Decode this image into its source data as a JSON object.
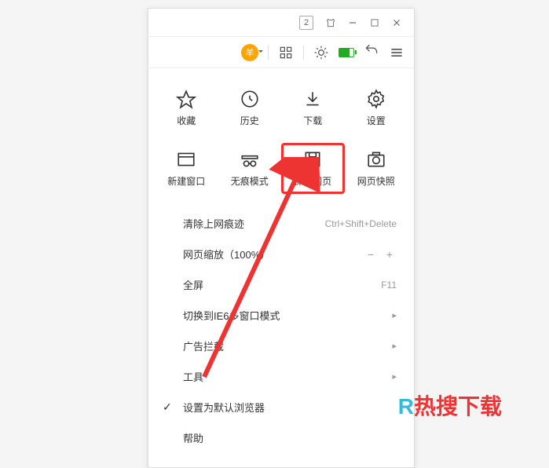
{
  "titlebar": {
    "badge_number": "2"
  },
  "avatar": {
    "char": "羊"
  },
  "grid_row1": [
    {
      "label": "收藏",
      "icon": "star"
    },
    {
      "label": "历史",
      "icon": "clock"
    },
    {
      "label": "下载",
      "icon": "download"
    },
    {
      "label": "设置",
      "icon": "gear"
    }
  ],
  "grid_row2": [
    {
      "label": "新建窗口",
      "icon": "window"
    },
    {
      "label": "无痕模式",
      "icon": "incognito"
    },
    {
      "label": "保存网页",
      "icon": "save",
      "highlighted": true
    },
    {
      "label": "网页快照",
      "icon": "camera"
    }
  ],
  "menu": {
    "clear_traces": {
      "label": "清除上网痕迹",
      "shortcut": "Ctrl+Shift+Delete"
    },
    "zoom": {
      "label": "网页缩放（100%）",
      "buttons": [
        "−",
        "+"
      ]
    },
    "fullscreen": {
      "label": "全屏",
      "shortcut": "F11"
    },
    "switch_ie6": {
      "label": "切换到IE6多窗口模式"
    },
    "adblock": {
      "label": "广告拦截"
    },
    "tools": {
      "label": "工具"
    },
    "set_default": {
      "label": "设置为默认浏览器"
    },
    "help": {
      "label": "帮助"
    }
  },
  "watermark": {
    "r": "R",
    "text": "热搜下载"
  }
}
